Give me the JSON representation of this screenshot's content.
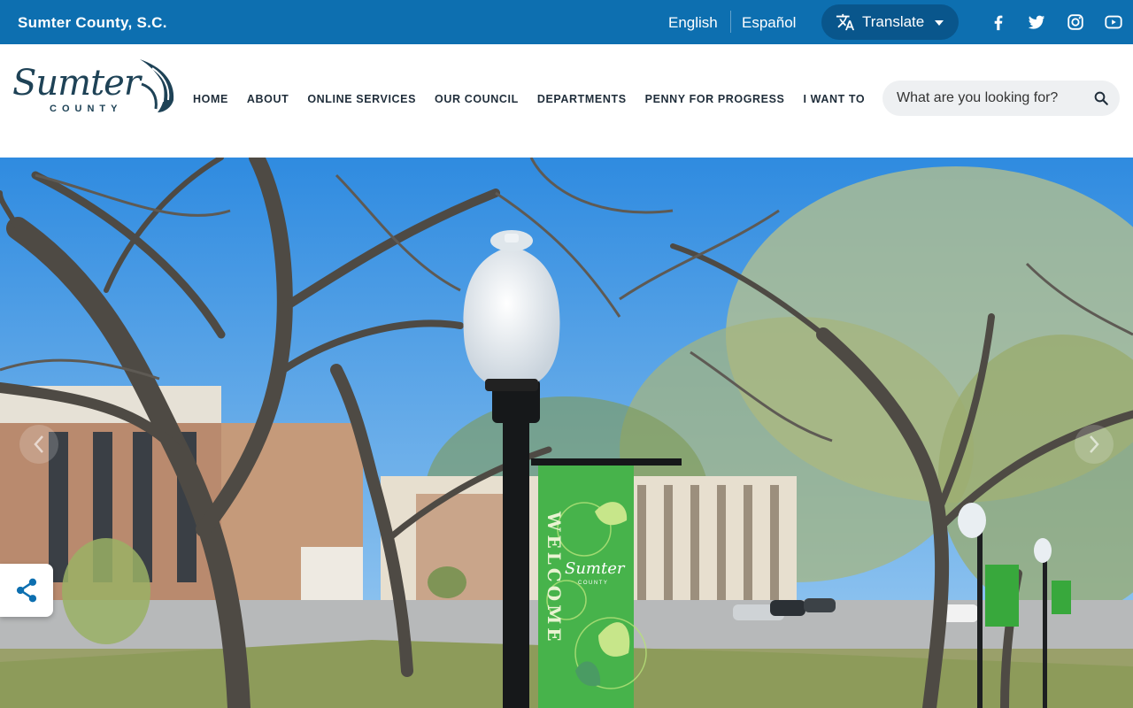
{
  "topbar": {
    "site_name": "Sumter County, S.C.",
    "languages": [
      "English",
      "Español"
    ],
    "translate_label": "Translate",
    "social_icons": [
      "facebook-icon",
      "twitter-icon",
      "instagram-icon",
      "youtube-icon"
    ]
  },
  "header": {
    "logo": {
      "word": "Sumter",
      "subword": "COUNTY"
    },
    "nav": [
      "HOME",
      "ABOUT",
      "ONLINE SERVICES",
      "OUR COUNCIL",
      "DEPARTMENTS",
      "PENNY FOR PROGRESS",
      "I WANT TO"
    ],
    "search": {
      "placeholder": "What are you looking for?"
    }
  },
  "hero": {
    "banner": {
      "vertical_text": "WELCOME",
      "logo_text": "Sumter",
      "logo_subtext": "COUNTY"
    }
  },
  "colors": {
    "topbar_bg": "#0d6fb0",
    "translate_bg": "#09568c",
    "nav_text": "#1f2d3a",
    "logo": "#1e4256",
    "share_icon": "#0d6fb0"
  }
}
